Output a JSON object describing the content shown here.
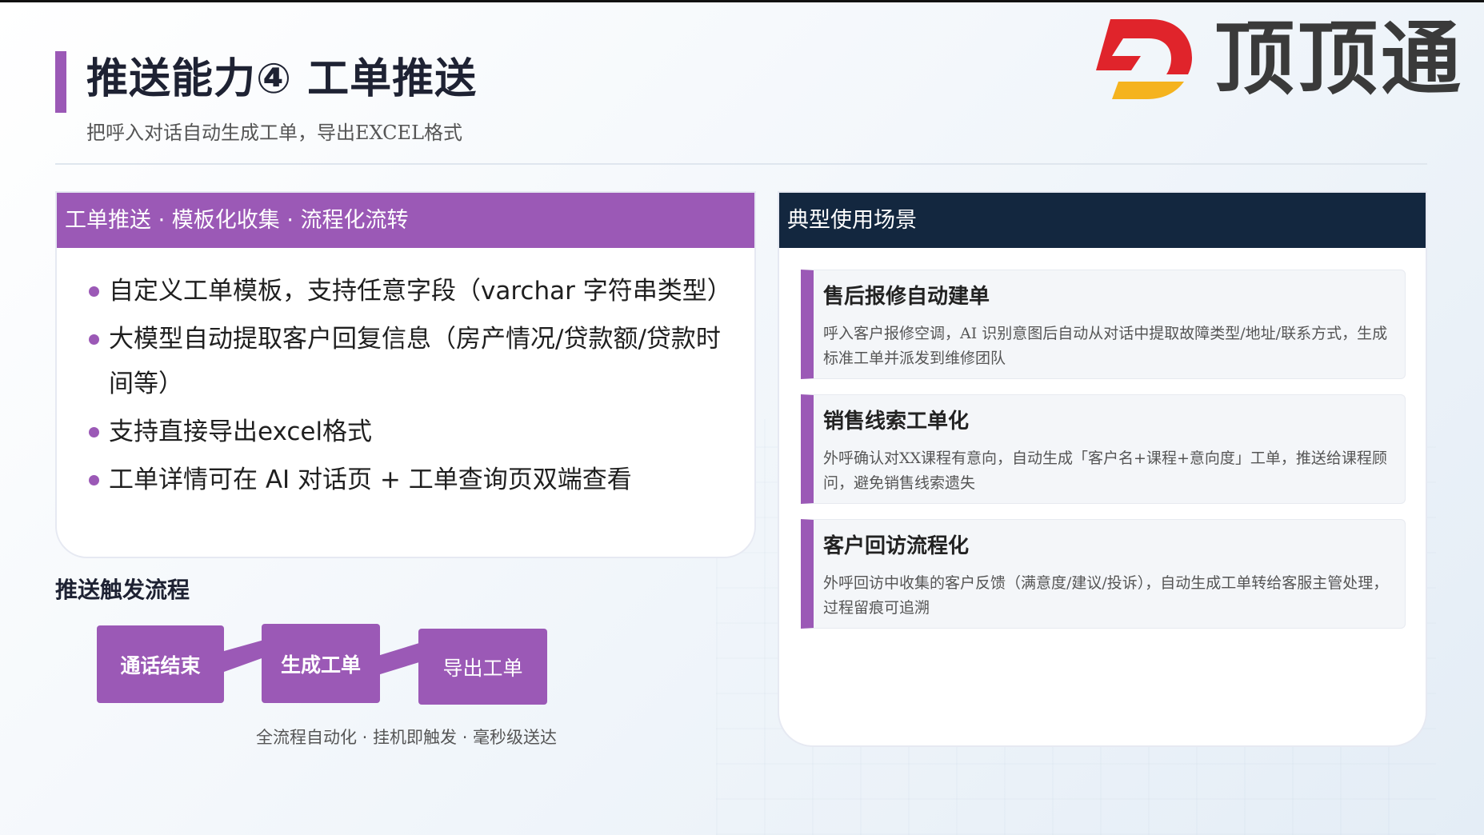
{
  "header": {
    "title": "推送能力④ 工单推送",
    "subtitle": "把呼入对话自动生成工单，导出EXCEL格式"
  },
  "logo": {
    "text": "顶顶通",
    "colors": {
      "red": "#e0242b",
      "yellow": "#f5b31e",
      "text": "#3a3a3a"
    }
  },
  "left_card": {
    "header": "工单推送 · 模板化收集 · 流程化流转",
    "items": [
      "自定义工单模板，支持任意字段（varchar 字符串类型）",
      "大模型自动提取客户回复信息（房产情况/贷款额/贷款时间等）",
      "支持直接导出excel格式",
      "工单详情可在 AI 对话页 + 工单查询页双端查看"
    ]
  },
  "flow": {
    "title": "推送触发流程",
    "steps": [
      "通话结束",
      "生成工单",
      "导出工单"
    ],
    "caption": "全流程自动化 · 挂机即触发 · 毫秒级送达"
  },
  "right_card": {
    "header": "典型使用场景",
    "scenarios": [
      {
        "title": "售后报修自动建单",
        "desc": "呼入客户报修空调，AI 识别意图后自动从对话中提取故障类型/地址/联系方式，生成标准工单并派发到维修团队"
      },
      {
        "title": "销售线索工单化",
        "desc": "外呼确认对XX课程有意向，自动生成「客户名+课程+意向度」工单，推送给课程顾问，避免销售线索遗失"
      },
      {
        "title": "客户回访流程化",
        "desc": "外呼回访中收集的客户反馈（满意度/建议/投诉），自动生成工单转给客服主管处理，过程留痕可追溯"
      }
    ]
  },
  "colors": {
    "accent": "#9b59b6",
    "navy": "#13273f"
  }
}
